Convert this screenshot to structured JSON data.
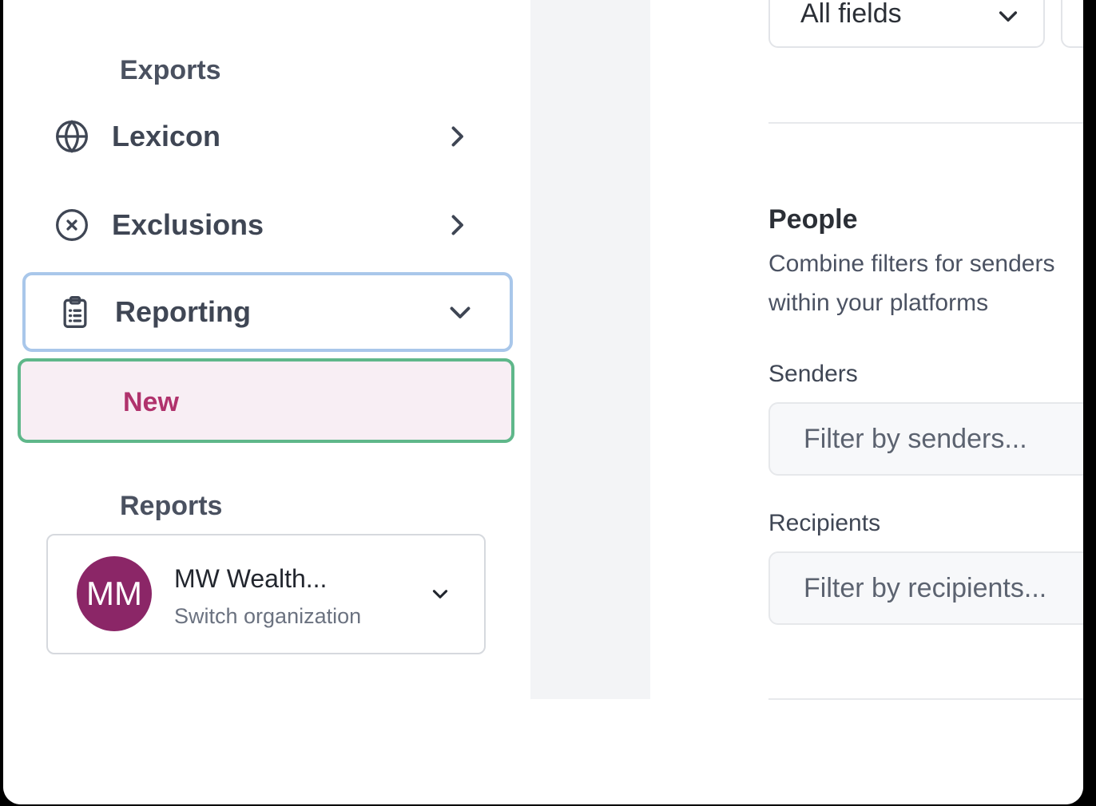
{
  "sidebar": {
    "items": [
      {
        "label": "Exports",
        "icon": "none"
      },
      {
        "label": "Lexicon",
        "icon": "globe-icon"
      },
      {
        "label": "Exclusions",
        "icon": "x-circle-icon"
      },
      {
        "label": "Reporting",
        "icon": "clipboard-list-icon",
        "expanded": true
      },
      {
        "label": "New",
        "active": true
      },
      {
        "label": "Reports"
      }
    ],
    "organization": {
      "initials": "MM",
      "name": "MW Wealth...",
      "subtitle": "Switch organization",
      "avatar_color": "#8b2667"
    }
  },
  "filters": {
    "field_select": "All fields",
    "people": {
      "title": "People",
      "description_line1": "Combine filters for senders",
      "description_line2": "within your platforms",
      "senders_label": "Senders",
      "senders_placeholder": "Filter by senders...",
      "recipients_label": "Recipients",
      "recipients_placeholder": "Filter by recipients..."
    }
  },
  "colors": {
    "active_text": "#b0326c",
    "active_bg": "#f8eef4",
    "focus_border": "#a9c7ea",
    "active_border": "#5fb78a"
  }
}
